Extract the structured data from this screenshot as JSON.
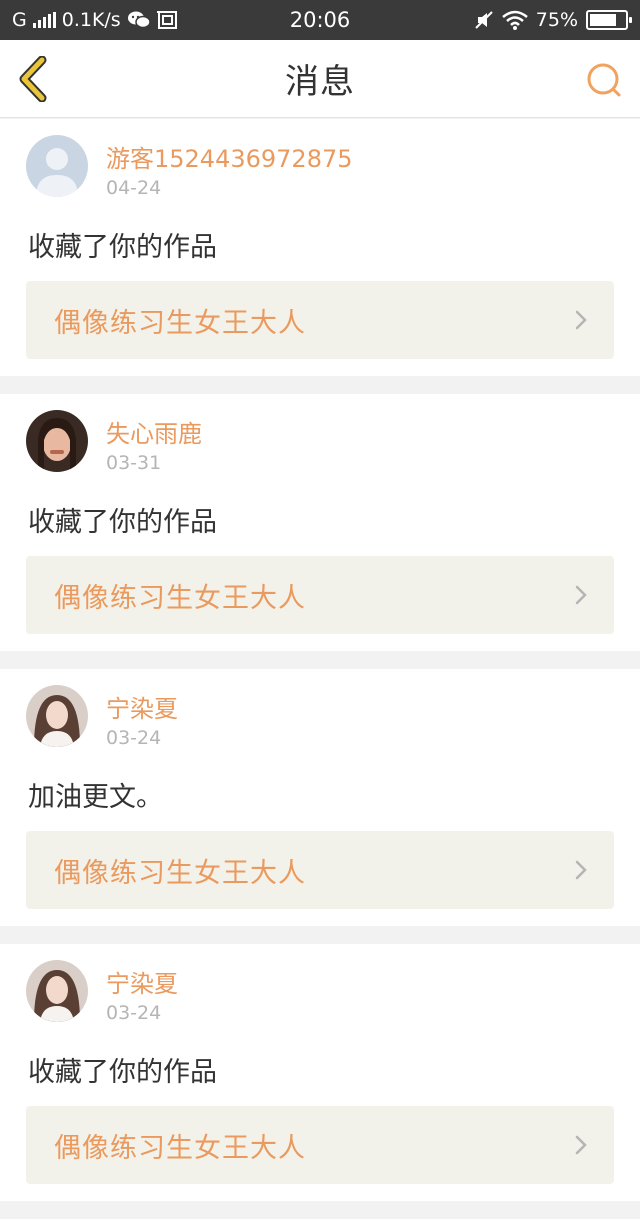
{
  "status_bar": {
    "network": "G",
    "speed": "0.1K/s",
    "time": "20:06",
    "battery": "75%",
    "battery_level": 0.75,
    "icons": [
      "signal-icon",
      "wechat-icon",
      "screenshot-icon",
      "mute-icon",
      "wifi-icon",
      "battery-icon"
    ]
  },
  "header": {
    "title": "消息",
    "back_icon": "back-chevron-icon",
    "search_icon": "search-icon",
    "accent_color": "#e8c53a",
    "search_color": "#f0a25f"
  },
  "messages": [
    {
      "username": "游客1524436972875",
      "date": "04-24",
      "text": "收藏了你的作品",
      "work": "偶像练习生女王大人",
      "avatar": "default-avatar"
    },
    {
      "username": "失心雨鹿",
      "date": "03-31",
      "text": "收藏了你的作品",
      "work": "偶像练习生女王大人",
      "avatar": "user-photo-avatar"
    },
    {
      "username": "宁染夏",
      "date": "03-24",
      "text": "加油更文。",
      "work": "偶像练习生女王大人",
      "avatar": "user-photo-avatar"
    },
    {
      "username": "宁染夏",
      "date": "03-24",
      "text": "收藏了你的作品",
      "work": "偶像练习生女王大人",
      "avatar": "user-photo-avatar"
    }
  ],
  "colors": {
    "username": "#ea9a5e",
    "work_title": "#ea9a5e",
    "work_bg": "#f3f2ea",
    "divider_bg": "#f2f2f2"
  }
}
